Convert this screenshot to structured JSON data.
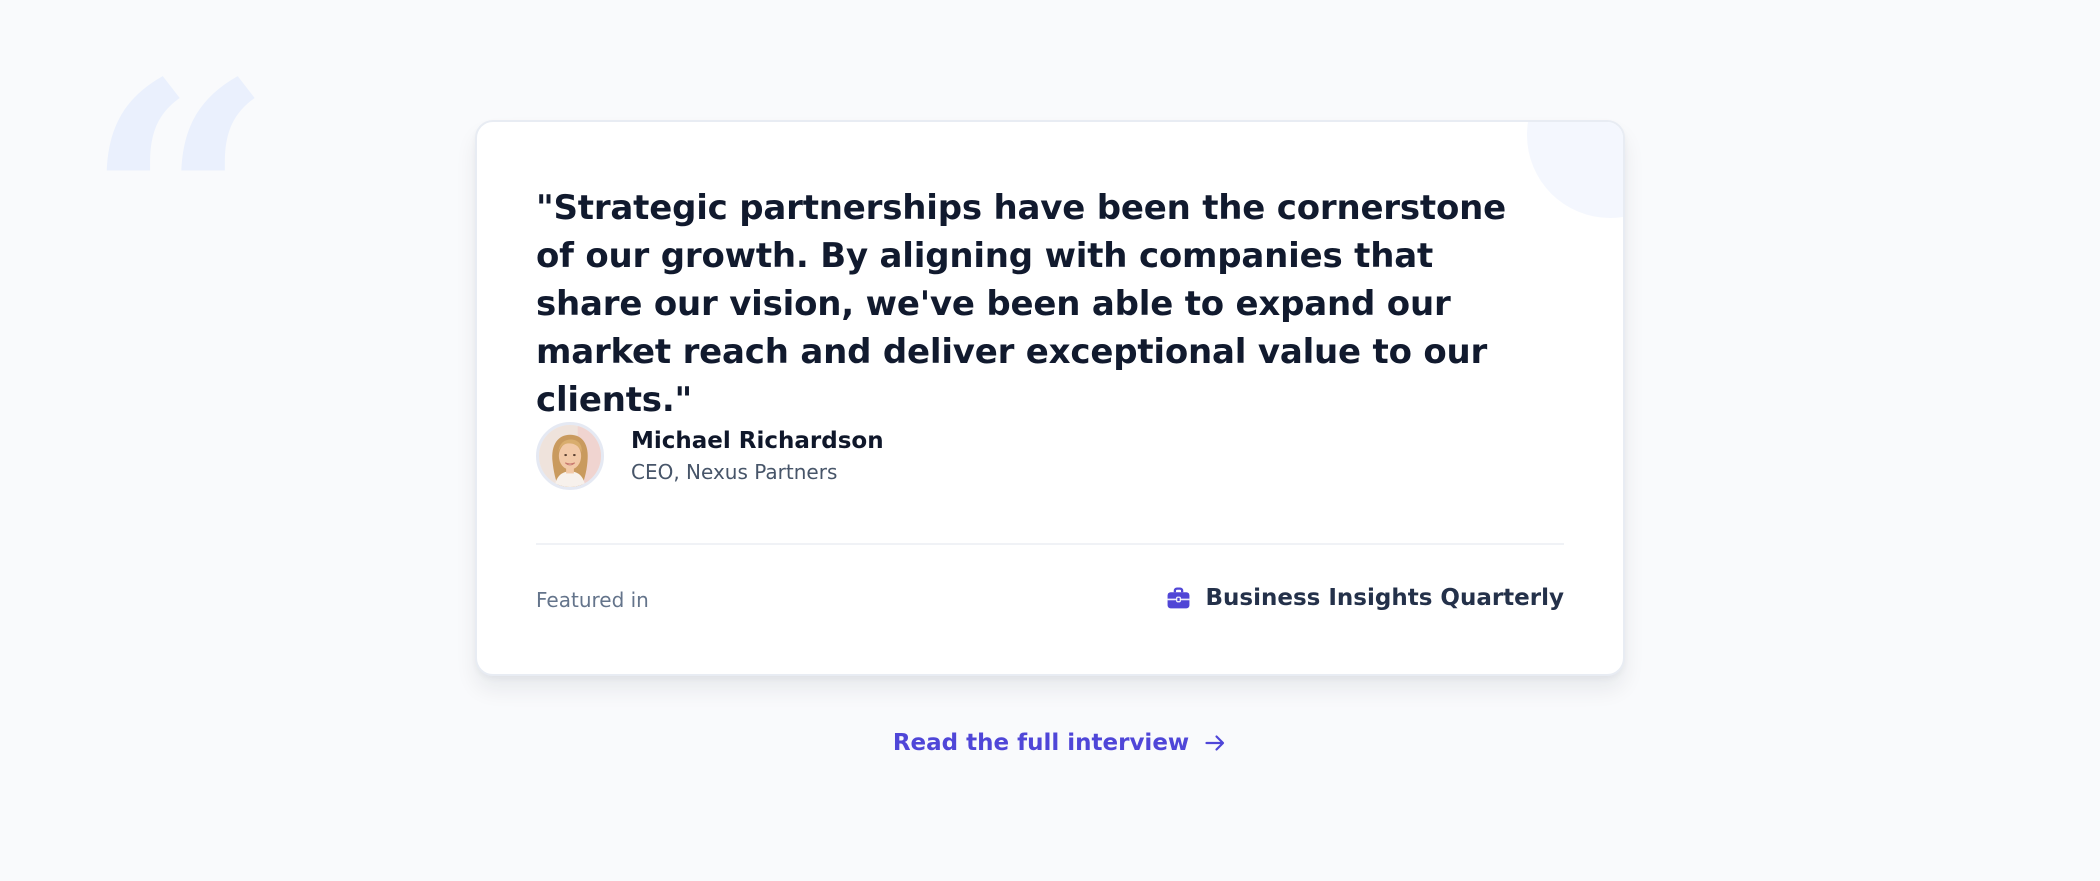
{
  "decor": {
    "quote_mark": "“"
  },
  "testimonial": {
    "quote": "\"Strategic partnerships have been the cornerstone of our growth. By aligning with companies that share our vision, we've been able to expand our market reach and deliver exceptional value to our clients.\"",
    "author": {
      "name": "Michael Richardson",
      "role": "CEO, Nexus Partners",
      "avatar_icon": "avatar-photo"
    }
  },
  "featured": {
    "label": "Featured in",
    "publication": "Business Insights Quarterly",
    "icon": "briefcase-icon"
  },
  "cta": {
    "label": "Read the full interview",
    "icon": "arrow-right-icon"
  },
  "colors": {
    "accent": "#4f46d8",
    "background": "#f9fafc",
    "card": "#ffffff",
    "text_primary": "#111a2e",
    "text_muted": "#64748b",
    "decor": "#eaf0fd"
  }
}
